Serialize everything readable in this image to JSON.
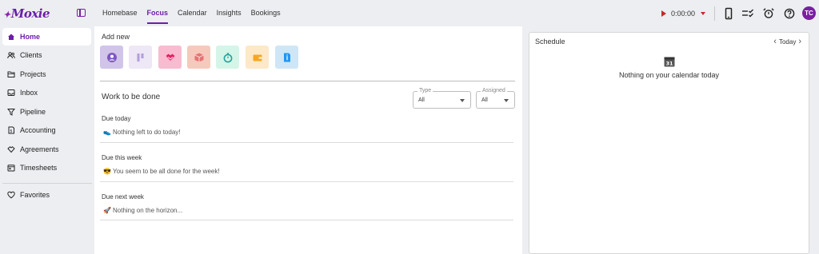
{
  "app": {
    "name": "Moxie"
  },
  "nav": {
    "tabs": [
      {
        "label": "Homebase"
      },
      {
        "label": "Focus",
        "active": true
      },
      {
        "label": "Calendar"
      },
      {
        "label": "Insights"
      },
      {
        "label": "Bookings"
      }
    ]
  },
  "timer": {
    "value": "0:00:00"
  },
  "user": {
    "initials": "TC"
  },
  "sidebar": {
    "items": [
      {
        "label": "Home",
        "icon": "home-icon",
        "active": true
      },
      {
        "label": "Clients",
        "icon": "clients-icon"
      },
      {
        "label": "Projects",
        "icon": "folder-icon"
      },
      {
        "label": "Inbox",
        "icon": "inbox-icon"
      },
      {
        "label": "Pipeline",
        "icon": "filter-icon"
      },
      {
        "label": "Accounting",
        "icon": "receipt-icon"
      },
      {
        "label": "Agreements",
        "icon": "handshake-icon"
      },
      {
        "label": "Timesheets",
        "icon": "timesheet-icon"
      },
      {
        "label": "Favorites",
        "icon": "heart-icon"
      }
    ]
  },
  "add_new": {
    "title": "Add new",
    "buttons": [
      {
        "icon": "contact-icon",
        "bg": "#d1c4e9"
      },
      {
        "icon": "kanban-icon",
        "bg": "#ede7f6"
      },
      {
        "icon": "handshake-icon",
        "bg": "#f8bbd0"
      },
      {
        "icon": "package-icon",
        "bg": "#f6c9bd"
      },
      {
        "icon": "stopwatch-icon",
        "bg": "#d5f5e9"
      },
      {
        "icon": "wallet-icon",
        "bg": "#fde9c8"
      },
      {
        "icon": "document-icon",
        "bg": "#cfe6f7"
      }
    ]
  },
  "work": {
    "title": "Work to be done",
    "filters": {
      "type": {
        "label": "Type",
        "value": "All"
      },
      "assigned": {
        "label": "Assigned",
        "value": "All"
      }
    },
    "groups": [
      {
        "title": "Due today",
        "emoji": "👟",
        "message": "Nothing left to do today!"
      },
      {
        "title": "Due this week",
        "emoji": "😎",
        "message": "You seem to be all done for the week!"
      },
      {
        "title": "Due next week",
        "emoji": "🚀",
        "message": "Nothing on the horizon..."
      }
    ]
  },
  "schedule": {
    "title": "Schedule",
    "today_label": "Today",
    "calendar_day": "31",
    "empty_message": "Nothing on your calendar today"
  },
  "colors": {
    "brand": "#6b1fa8",
    "timer_red": "#c62828"
  }
}
